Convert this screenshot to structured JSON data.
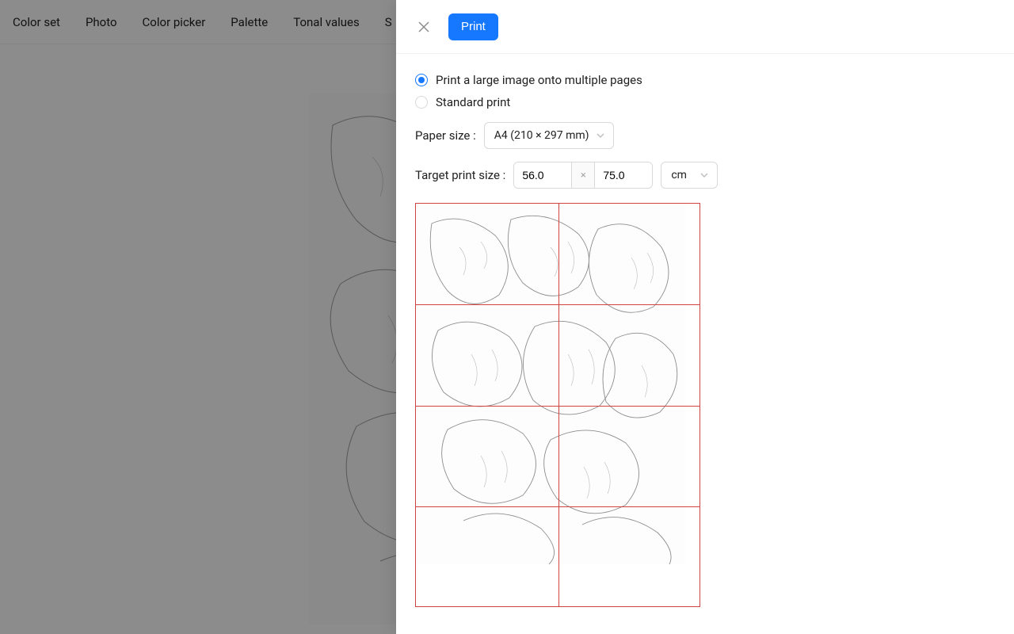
{
  "nav": {
    "items": [
      "Color set",
      "Photo",
      "Color picker",
      "Palette",
      "Tonal values",
      "S"
    ]
  },
  "drawer": {
    "print_button": "Print",
    "radio_multi": "Print a large image onto multiple pages",
    "radio_standard": "Standard print",
    "paper_size_label": "Paper size :",
    "paper_size_value": "A4 (210 × 297 mm)",
    "target_size_label": "Target print size :",
    "width_value": "56.0",
    "height_value": "75.0",
    "times": "×",
    "unit_value": "cm"
  }
}
